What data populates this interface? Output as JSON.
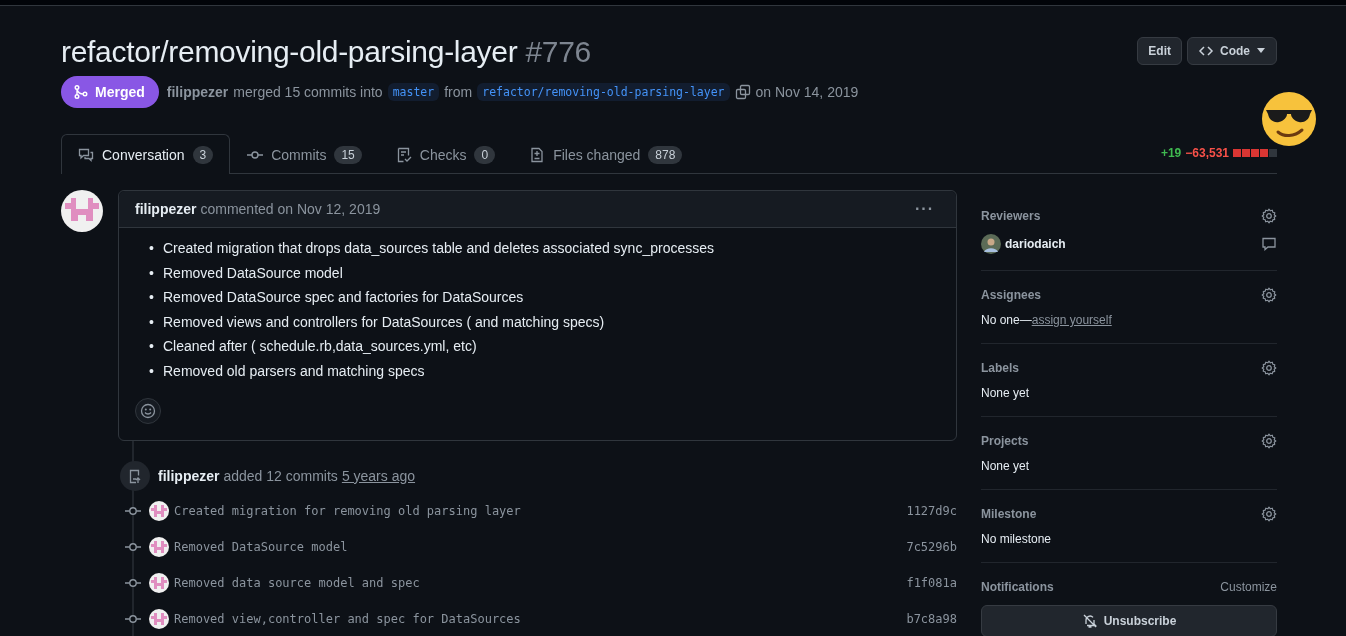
{
  "header": {
    "title": "refactor/removing-old-parsing-layer",
    "number": "#776",
    "buttons": [
      "Edit",
      "Code"
    ]
  },
  "meta": {
    "state": "Merged",
    "author": "filippezer",
    "text": "merged 15 commits into",
    "base": "master",
    "from": "from",
    "head": "refactor/removing-old-parsing-layer",
    "date": "on Nov 14, 2019"
  },
  "tabs": [
    {
      "label": "Conversation",
      "count": "3",
      "selected": true
    },
    {
      "label": "Commits",
      "count": "15",
      "selected": false
    },
    {
      "label": "Checks",
      "count": "0",
      "selected": false
    },
    {
      "label": "Files changed",
      "count": "878",
      "selected": false
    }
  ],
  "diffstat": {
    "added": "+19",
    "removed": "−63,531"
  },
  "comment": {
    "author": "filippezer",
    "action": "commented on Nov 12, 2019",
    "menu": "···",
    "bullet": "•",
    "items": [
      "Created migration that drops data_sources table and deletes associated sync_processes",
      "Removed DataSource model",
      "Removed DataSource spec and factories for DataSources",
      "Removed views and controllers for DataSources ( and matching specs)",
      "Cleaned after ( schedule.rb,data_sources.yml, etc)",
      "Removed old parsers and matching specs"
    ]
  },
  "timeline": {
    "author": "filippezer",
    "action": "added 12 commits",
    "time": "5 years ago",
    "commits": [
      {
        "message": "Created migration for removing old parsing layer",
        "sha": "1127d9c"
      },
      {
        "message": "Removed DataSource model",
        "sha": "7c5296b"
      },
      {
        "message": "Removed data source model and spec",
        "sha": "f1f081a"
      },
      {
        "message": "Removed view,controller and spec for DataSources",
        "sha": "b7c8a98"
      }
    ]
  },
  "sidebar": [
    {
      "title": "Reviewers",
      "kind": "reviewer",
      "value": "dariodaich"
    },
    {
      "title": "Assignees",
      "kind": "assignee",
      "value": "No one—",
      "link": "assign yourself"
    },
    {
      "title": "Labels",
      "kind": "text",
      "value": "None yet"
    },
    {
      "title": "Projects",
      "kind": "text",
      "value": "None yet"
    },
    {
      "title": "Milestone",
      "kind": "text",
      "value": "No milestone"
    },
    {
      "title": "Notifications",
      "kind": "notifications",
      "link": "Customize",
      "value": "Unsubscribe"
    }
  ]
}
